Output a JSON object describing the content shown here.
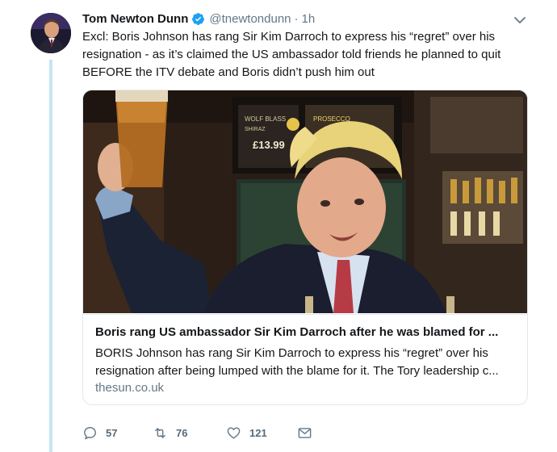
{
  "author": {
    "name": "Tom Newton Dunn",
    "handle": "@tnewtondunn",
    "separator": "·",
    "time": "1h"
  },
  "tweet": {
    "text": "Excl: Boris Johnson has rang Sir Kim Darroch to express his “regret” over his resignation - as it’s claimed the US ambassador told friends he planned to quit BEFORE the ITV debate and Boris didn’t push him out"
  },
  "card": {
    "image_icon": "photo-of-man-raising-beer-glass-at-bar",
    "sign_text": [
      "WOLF BLASS",
      "SHIRAZ",
      "£13.99",
      "PROSECCO"
    ],
    "title": "Boris rang US ambassador Sir Kim Darroch after he was blamed for ...",
    "description": "BORIS Johnson has rang Sir Kim Darroch to express his “regret” over his resignation after being lumped with the blame for it. The Tory leadership c...",
    "domain": "thesun.co.uk"
  },
  "actions": {
    "replies": "57",
    "retweets": "76",
    "likes": "121"
  },
  "colors": {
    "accent": "#1da1f2",
    "thread_line": "#c4e5f5",
    "muted": "#657786"
  }
}
